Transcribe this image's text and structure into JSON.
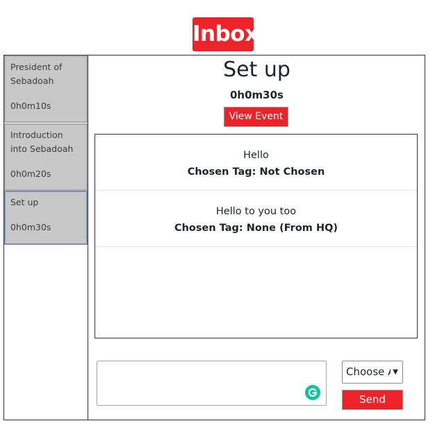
{
  "header": {
    "title": "Inbox"
  },
  "sidebar": {
    "items": [
      {
        "title": "President of Sebadoah",
        "time": "0h0m10s"
      },
      {
        "title": "Introduction into Sebadoah",
        "time": "0h0m20s"
      },
      {
        "title": "Set up",
        "time": "0h0m30s"
      }
    ]
  },
  "event": {
    "title": "Set up",
    "timer": "0h0m30s",
    "view_event_label": "View Event"
  },
  "messages": [
    {
      "text": "Hello",
      "tag": "Chosen Tag: Not Chosen"
    },
    {
      "text": "Hello to you too",
      "tag": "Chosen Tag: None (From HQ)"
    }
  ],
  "composer": {
    "input_value": "",
    "tag_select_value": "Choose A",
    "send_label": "Send"
  },
  "colors": {
    "accent": "#ee2229",
    "grammar_badge": "#15c39a",
    "sidebar_bg": "#c8c8c8"
  }
}
